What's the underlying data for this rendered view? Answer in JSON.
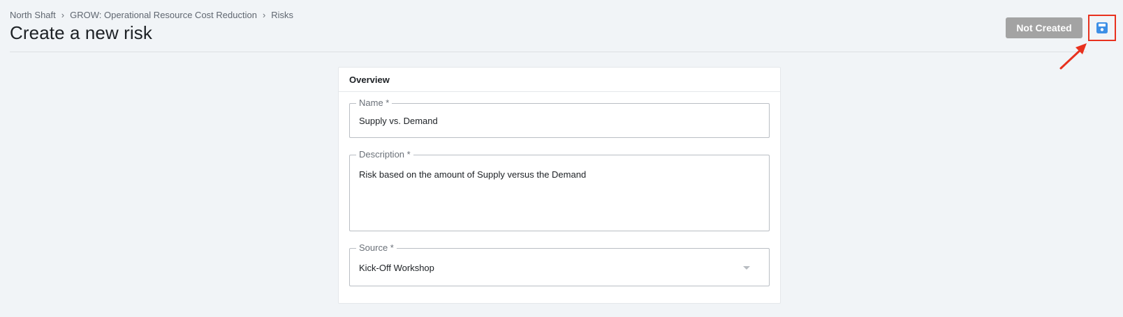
{
  "breadcrumb": {
    "items": [
      "North Shaft",
      "GROW: Operational Resource Cost Reduction",
      "Risks"
    ],
    "separator": "›"
  },
  "page": {
    "title": "Create a new risk"
  },
  "toolbar": {
    "status_label": "Not Created",
    "save_icon": "save-icon",
    "highlight_color": "#e8311e"
  },
  "form": {
    "section_title": "Overview",
    "name": {
      "label": "Name *",
      "value": "Supply vs. Demand"
    },
    "description": {
      "label": "Description *",
      "value": "Risk based on the amount of Supply versus the Demand"
    },
    "source": {
      "label": "Source *",
      "value": "Kick-Off Workshop"
    }
  }
}
